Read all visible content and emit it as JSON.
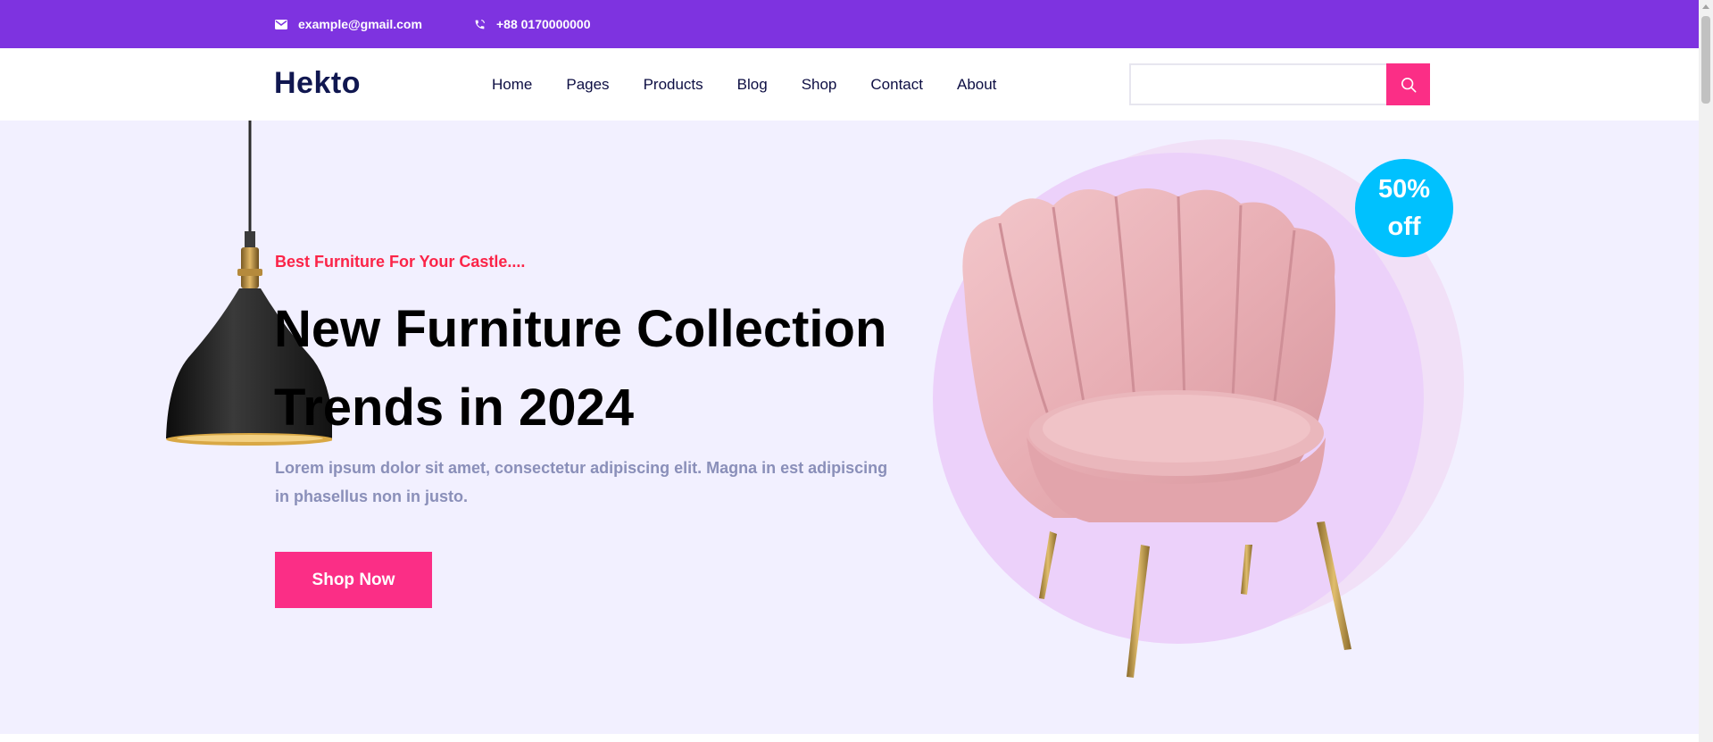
{
  "topbar": {
    "email": "example@gmail.com",
    "phone": "+88 0170000000",
    "email_icon": "mail-icon",
    "phone_icon": "phone-icon",
    "background": "#7e33e0"
  },
  "nav": {
    "logo": "Hekto",
    "menu": [
      "Home",
      "Pages",
      "Products",
      "Blog",
      "Shop",
      "Contact",
      "About"
    ],
    "search_placeholder": "",
    "search_icon": "search-icon",
    "accent": "#fb2e86"
  },
  "hero": {
    "subtitle": "Best Furniture For Your Castle....",
    "title_line1": "New Furniture Collection",
    "title_line2": "Trends in 2024",
    "description": "Lorem ipsum dolor sit amet, consectetur adipiscing elit. Magna in est adipiscing in phasellus non in justo.",
    "cta": "Shop Now",
    "badge_line1": "50%",
    "badge_line2": "off",
    "background": "#f2f0ff",
    "subtitle_color": "#fb2448",
    "badge_color": "#00c1fe"
  }
}
